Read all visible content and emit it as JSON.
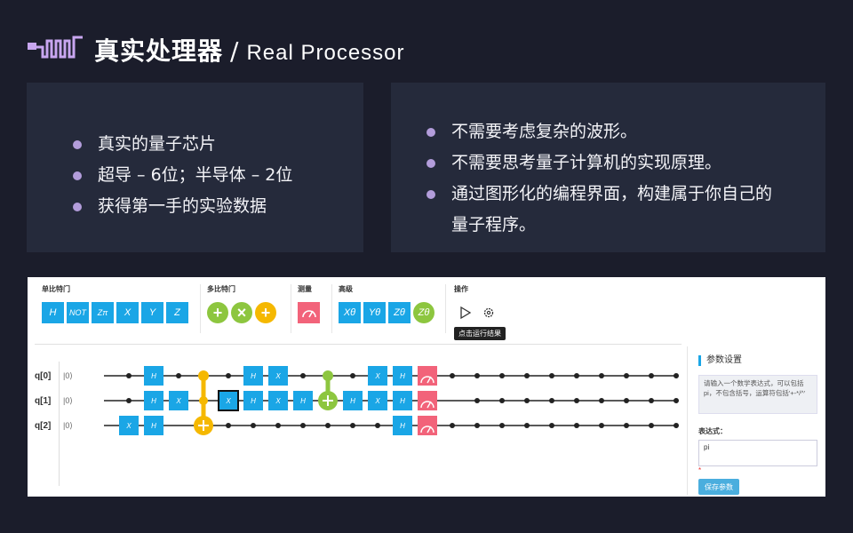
{
  "header": {
    "title_cn": "真实处理器",
    "separator": "/",
    "title_en": "Real Processor"
  },
  "left_card": {
    "bullets": [
      "真实的量子芯片",
      "超导 – 6位；半导体 – 2位",
      "获得第一手的实验数据"
    ]
  },
  "right_card": {
    "bullets": [
      "不需要考虑复杂的波形。",
      "不需要思考量子计算机的实现原理。",
      "通过图形化的编程界面，构建属于你自己的",
      "量子程序。"
    ]
  },
  "toolbar": {
    "single": {
      "label": "单比特门",
      "gates": [
        "H",
        "NOT",
        "Zπ",
        "X",
        "Y",
        "Z"
      ]
    },
    "multi": {
      "label": "多比特门",
      "gates": [
        "+",
        "×",
        "+"
      ]
    },
    "measure": {
      "label": "测量"
    },
    "advanced": {
      "label": "高级",
      "gates": [
        "Xθ",
        "Yθ",
        "Zθ",
        "Zθ"
      ]
    },
    "ops": {
      "label": "操作",
      "run_tooltip": "点击运行结果"
    }
  },
  "circuit": {
    "qubits": [
      "q[0]",
      "q[1]",
      "q[2]"
    ],
    "initial_state": "|0⟩"
  },
  "params": {
    "title": "参数设置",
    "hint": "请输入一个数学表达式，可以包括pi，不包含括号，运算符包括'+-*/^'",
    "expr_label": "表达式：",
    "expr_value": "pi",
    "required_mark": "*",
    "save_label": "保存参数"
  },
  "colors": {
    "gate": "#1aa6e6",
    "control": "#f5b800",
    "green": "#8dc63f",
    "measure": "#f2637a",
    "accent": "#b39ddb"
  }
}
